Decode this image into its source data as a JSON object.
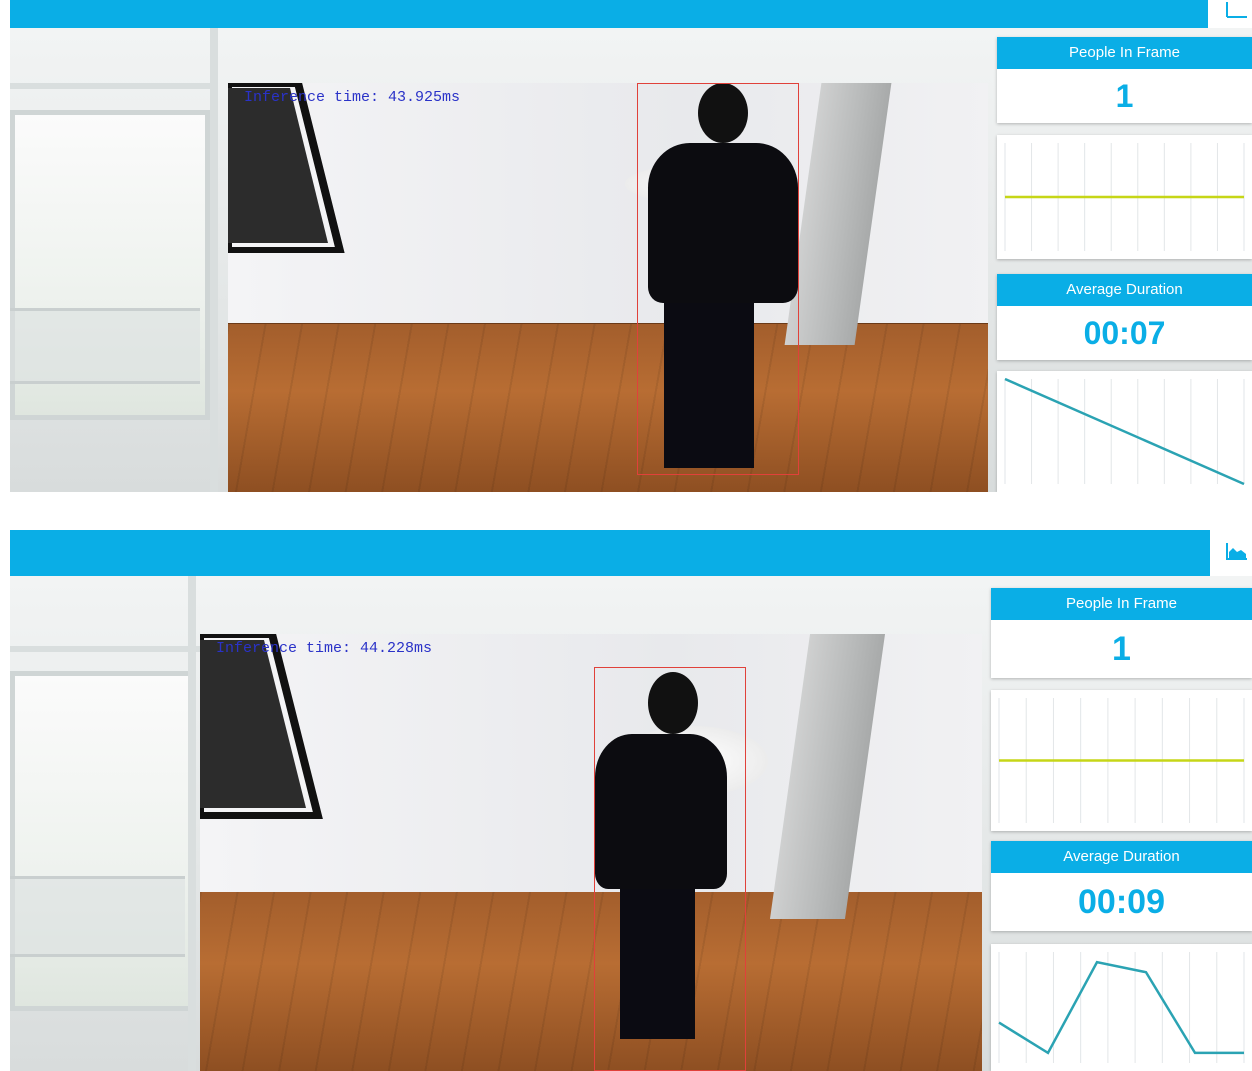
{
  "colors": {
    "brand": "#0aaee6",
    "bbox": "#e0413a",
    "inference_text": "#2a32c8",
    "people_line": "#c6d617",
    "duration_line": "#2ba3b3"
  },
  "icons": {
    "chart_toggle": "area-chart-icon"
  },
  "frames": [
    {
      "inference_text": "Inference time: 43.925ms",
      "people_in_frame_label": "People In Frame",
      "people_in_frame_value": "1",
      "average_duration_label": "Average Duration",
      "average_duration_value": "00:07",
      "people_graph": {
        "type": "line",
        "y": [
          1,
          1,
          1,
          1,
          1,
          1,
          1,
          1
        ],
        "ylim": [
          0,
          2
        ]
      },
      "duration_graph": {
        "type": "line",
        "y": [
          10,
          0
        ],
        "ylim": [
          0,
          10
        ]
      }
    },
    {
      "inference_text": "Inference time: 44.228ms",
      "people_in_frame_label": "People In Frame",
      "people_in_frame_value": "1",
      "average_duration_label": "Average Duration",
      "average_duration_value": "00:09",
      "people_graph": {
        "type": "line",
        "y": [
          1,
          1,
          1,
          1,
          1,
          1,
          1,
          1
        ],
        "ylim": [
          0,
          2
        ]
      },
      "duration_graph": {
        "type": "line",
        "y": [
          4,
          1,
          10,
          9,
          1,
          1
        ],
        "ylim": [
          0,
          11
        ]
      }
    }
  ]
}
